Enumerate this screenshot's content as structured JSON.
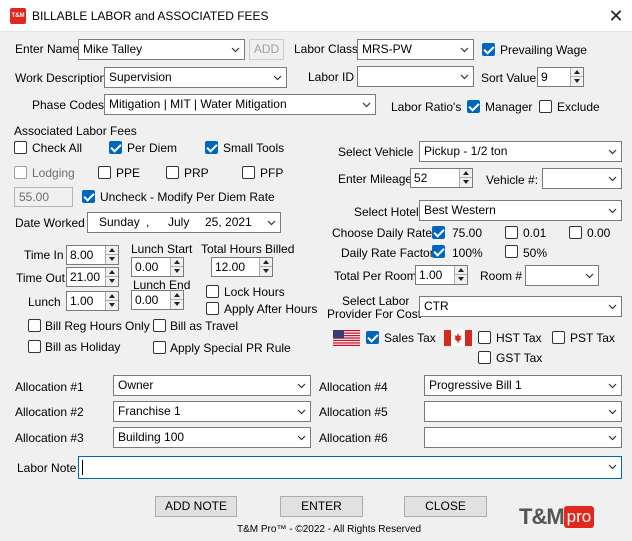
{
  "window": {
    "title": "BILLABLE LABOR and ASSOCIATED FEES",
    "app_icon_text": "T&M"
  },
  "labels": {
    "enter_name": "Enter Name",
    "labor_class": "Labor Class",
    "prevailing_wage": "Prevailing Wage",
    "work_description": "Work Description",
    "labor_id": "Labor ID",
    "sort_value": "Sort Value",
    "phase_codes": "Phase Codes",
    "labor_ratios": "Labor Ratio's",
    "manager": "Manager",
    "exclude": "Exclude",
    "associated_fees": "Associated Labor Fees",
    "check_all": "Check All",
    "per_diem": "Per Diem",
    "small_tools": "Small Tools",
    "lodging": "Lodging",
    "ppe": "PPE",
    "prp": "PRP",
    "pfp": "PFP",
    "uncheck_modify": "Uncheck - Modify Per Diem Rate",
    "date_worked": "Date Worked",
    "time_in": "Time In",
    "lunch_start": "Lunch Start",
    "total_hours_billed": "Total Hours Billed",
    "time_out": "Time Out",
    "lunch_end": "Lunch End",
    "lunch": "Lunch",
    "lock_hours": "Lock Hours",
    "apply_after_hours": "Apply After Hours",
    "bill_reg_hours_only": "Bill Reg Hours Only",
    "bill_as_travel": "Bill as Travel",
    "bill_as_holiday": "Bill as Holiday",
    "apply_special_pr_rule": "Apply Special PR Rule",
    "select_vehicle": "Select Vehicle",
    "enter_mileage": "Enter Mileage",
    "vehicle_num": "Vehicle #:",
    "select_hotel": "Select Hotel",
    "choose_daily_rate": "Choose Daily Rate",
    "daily_rate_factor": "Daily Rate Factor",
    "total_per_room": "Total Per Room",
    "room_num": "Room #",
    "select_labor_provider_1": "Select Labor",
    "select_labor_provider_2": "Provider For Cost",
    "sales_tax": "Sales Tax",
    "hst_tax": "HST Tax",
    "pst_tax": "PST Tax",
    "gst_tax": "GST Tax",
    "alloc1": "Allocation #1",
    "alloc2": "Allocation #2",
    "alloc3": "Allocation #3",
    "alloc4": "Allocation #4",
    "alloc5": "Allocation #5",
    "alloc6": "Allocation #6",
    "labor_note": "Labor Note"
  },
  "values": {
    "name": "Mike Talley",
    "labor_class": "MRS-PW",
    "work_description": "Supervision",
    "labor_id": "",
    "sort_value": "9",
    "phase_codes": "Mitigation | MIT | Water Mitigation",
    "per_diem_rate": "55.00",
    "date_weekday": "Sunday",
    "date_sep": ",",
    "date_month": "July",
    "date_day_year": "25, 2021",
    "time_in": "8.00",
    "lunch_start": "0.00",
    "total_hours": "12.00",
    "time_out": "21.00",
    "lunch_end": "0.00",
    "lunch": "1.00",
    "vehicle": "Pickup - 1/2 ton",
    "mileage": "52",
    "vehicle_num": "",
    "hotel": "Best Western",
    "rate_75": "75.00",
    "rate_001": "0.01",
    "rate_000": "0.00",
    "factor_100": "100%",
    "factor_50": "50%",
    "total_per_room": "1.00",
    "room_num": "",
    "labor_provider": "CTR",
    "alloc1": "Owner",
    "alloc2": "Franchise 1",
    "alloc3": "Building 100",
    "alloc4": "Progressive Bill 1",
    "alloc5": "",
    "alloc6": "",
    "labor_note": ""
  },
  "buttons": {
    "add": "ADD",
    "add_note": "ADD NOTE",
    "enter": "ENTER",
    "close": "CLOSE"
  },
  "footer": {
    "copyright": "T&M Pro™ - ©2022 - All Rights Reserved",
    "logo_tm": "T&M",
    "logo_pro": "pro"
  },
  "colors": {
    "accent": "#0067c0",
    "brand_red": "#e0281e",
    "logo_gray": "#555555"
  }
}
